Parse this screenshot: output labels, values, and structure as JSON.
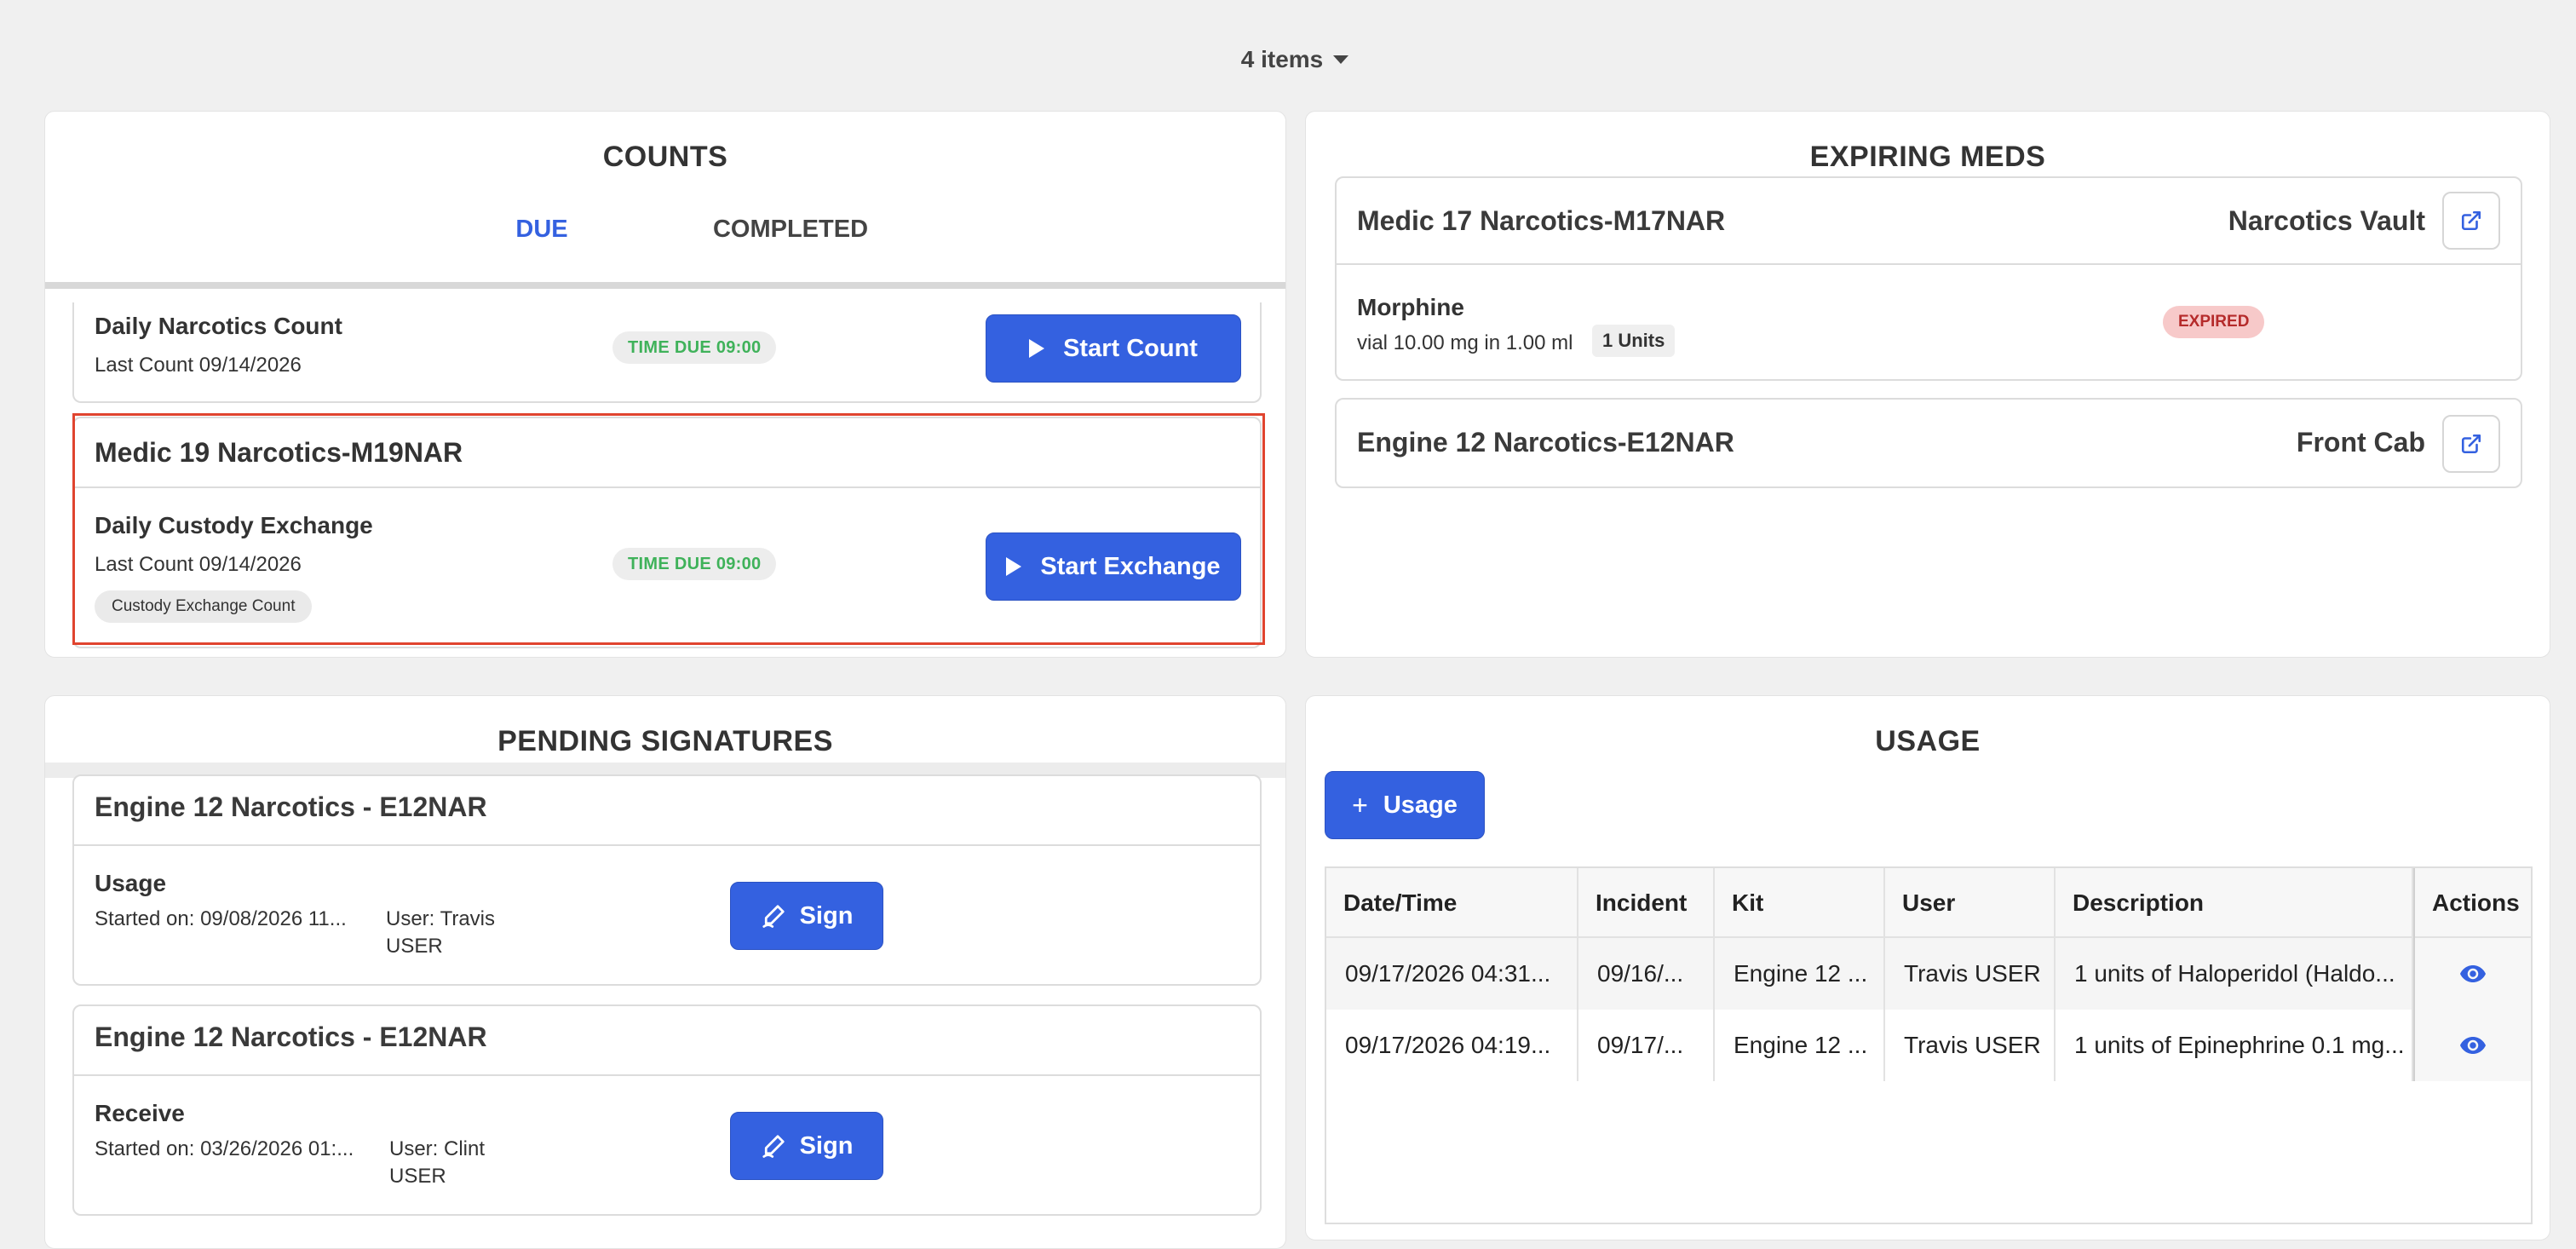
{
  "header": {
    "items_label": "4 items"
  },
  "counts": {
    "title": "COUNTS",
    "tabs": [
      {
        "label": "DUE"
      },
      {
        "label": "COMPLETED"
      }
    ],
    "cards": [
      {
        "task": "Daily Narcotics Count",
        "last_count": "Last Count  09/14/2026",
        "time_due": "TIME DUE  09:00",
        "button": "Start Count"
      },
      {
        "kit": "Medic 19 Narcotics-M19NAR",
        "task": "Daily Custody Exchange",
        "last_count": "Last Count  09/14/2026",
        "time_due": "TIME DUE  09:00",
        "chip": "Custody Exchange Count",
        "button": "Start Exchange"
      }
    ]
  },
  "expiring": {
    "title": "EXPIRING MEDS",
    "cards": [
      {
        "kit": "Medic 17 Narcotics-M17NAR",
        "location": "Narcotics Vault",
        "med": {
          "name": "Morphine",
          "detail": "vial 10.00 mg in 1.00 ml",
          "units": "1 Units",
          "status": "EXPIRED"
        }
      },
      {
        "kit": "Engine 12 Narcotics-E12NAR",
        "location": "Front Cab"
      }
    ]
  },
  "pending": {
    "title": "PENDING SIGNATURES",
    "cards": [
      {
        "kit": "Engine 12 Narcotics - E12NAR",
        "type": "Usage",
        "started": "Started on: 09/08/2026 11...",
        "user_line1": "User: Travis",
        "user_line2": "USER",
        "button": "Sign"
      },
      {
        "kit": "Engine 12 Narcotics - E12NAR",
        "type": "Receive",
        "started": "Started on: 03/26/2026 01:...",
        "user_line1": "User: Clint",
        "user_line2": "USER",
        "button": "Sign"
      }
    ]
  },
  "usage": {
    "title": "USAGE",
    "button": "Usage",
    "columns": [
      "Date/Time",
      "Incident",
      "Kit",
      "User",
      "Description",
      "Actions"
    ],
    "rows": [
      {
        "datetime": "09/17/2026 04:31...",
        "incident": "09/16/...",
        "kit": "Engine 12 ...",
        "user": "Travis USER",
        "description": "1 units of Haloperidol (Haldo..."
      },
      {
        "datetime": "09/17/2026 04:19...",
        "incident": "09/17/...",
        "kit": "Engine 12 ...",
        "user": "Travis USER",
        "description": "1 units of Epinephrine 0.1 mg..."
      }
    ]
  },
  "colors": {
    "accent": "#3461e0",
    "time_due": "#3fb25a",
    "expired_bg": "#f7c9c9",
    "expired_text": "#b52b2b",
    "highlight": "#e0442f"
  }
}
